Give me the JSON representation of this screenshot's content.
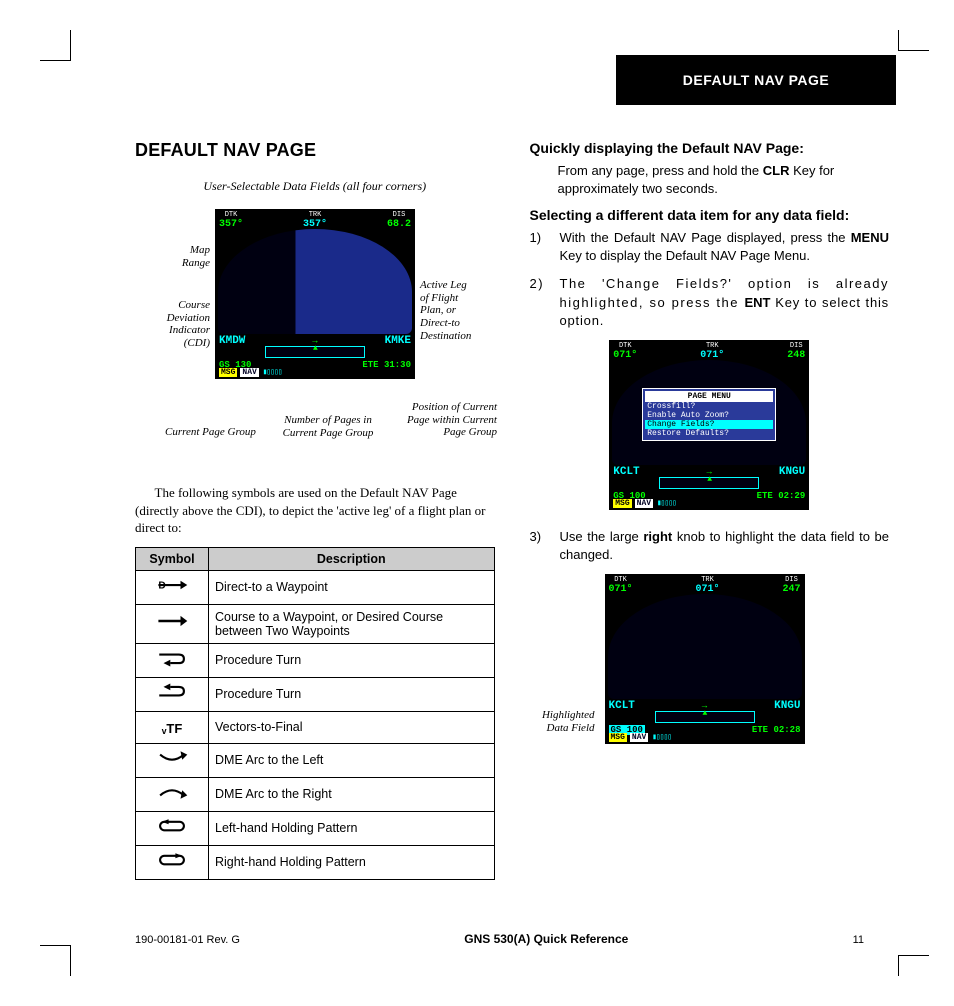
{
  "header_tab": "DEFAULT NAV PAGE",
  "left": {
    "title": "DEFAULT NAV PAGE",
    "annot_top": "User-Selectable Data Fields (all four corners)",
    "annot_map_range": "Map\nRange",
    "annot_cdi": "Course\nDeviation\nIndicator\n(CDI)",
    "annot_active_leg": "Active Leg\nof Flight\nPlan, or\nDirect-to\nDestination",
    "annot_cpg": "Current Page Group",
    "annot_npg": "Number of Pages in\nCurrent Page Group",
    "annot_pos": "Position of Current\nPage within Current\nPage Group",
    "gps1": {
      "dtk_lbl": "DTK",
      "dtk": "357°",
      "trk_lbl": "TRK",
      "trk": "357°",
      "dis_lbl": "DIS",
      "dis": "68.2",
      "gs_lbl": "GS",
      "gs": "130",
      "from": "KMDW",
      "to": "KMKE",
      "ete_lbl": "ETE",
      "ete": "31:30",
      "msg": "MSG",
      "nav": "NAV"
    },
    "para": "The following symbols are used on the Default NAV Page (directly above the CDI), to depict the 'active leg' of a flight plan or direct to:",
    "th_sym": "Symbol",
    "th_desc": "Description",
    "rows": [
      {
        "desc": "Direct-to a Waypoint"
      },
      {
        "desc": "Course to a Waypoint, or Desired Course between Two Waypoints"
      },
      {
        "desc": "Procedure Turn"
      },
      {
        "desc": "Procedure Turn"
      },
      {
        "desc": "Vectors-to-Final"
      },
      {
        "desc": "DME Arc to the Left"
      },
      {
        "desc": "DME Arc to the Right"
      },
      {
        "desc": "Left-hand Holding Pattern"
      },
      {
        "desc": "Right-hand Holding Pattern"
      }
    ]
  },
  "right": {
    "sub1": "Quickly displaying the Default NAV Page:",
    "para1a": "From any page, press and hold the ",
    "para1b": "CLR",
    "para1c": " Key for approximately two seconds.",
    "sub2": "Selecting a different data item for any data field:",
    "step1a": "With the Default NAV Page displayed, press the ",
    "step1b": "MENU",
    "step1c": " Key to display the Default NAV Page Menu.",
    "step2a": "The 'Change Fields?' option is already highlighted, so press the ",
    "step2b": "ENT",
    "step2c": " Key to select this option.",
    "gps2": {
      "dtk_lbl": "DTK",
      "dtk": "071°",
      "trk_lbl": "TRK",
      "trk": "071°",
      "dis_lbl": "DIS",
      "dis": "248",
      "gs_lbl": "GS",
      "gs": "100",
      "from": "KCLT",
      "to": "KNGU",
      "ete_lbl": "ETE",
      "ete": "02:29",
      "menu_hdr": "PAGE MENU",
      "menu1": "Crossfill?",
      "menu2": "Enable Auto Zoom?",
      "menu3": "Change Fields?",
      "menu4": "Restore Defaults?",
      "msg": "MSG",
      "nav": "NAV"
    },
    "step3a": "Use the large ",
    "step3b": "right",
    "step3c": " knob to highlight the data field to be changed.",
    "gps3": {
      "dtk_lbl": "DTK",
      "dtk": "071°",
      "trk_lbl": "TRK",
      "trk": "071°",
      "dis_lbl": "DIS",
      "dis": "247",
      "gs_lbl": "GS",
      "gs": "100",
      "from": "KCLT",
      "to": "KNGU",
      "ete_lbl": "ETE",
      "ete": "02:28",
      "msg": "MSG",
      "nav": "NAV"
    },
    "hl_label": "Highlighted\nData Field"
  },
  "footer": {
    "left": "190-00181-01  Rev. G",
    "mid": "GNS 530(A) Quick Reference",
    "right": "11"
  }
}
